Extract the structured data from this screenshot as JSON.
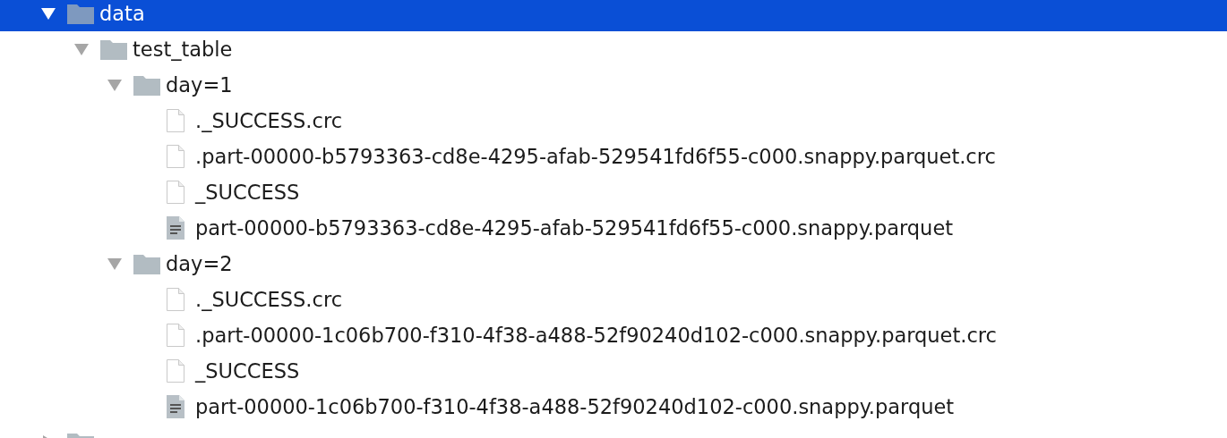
{
  "tree": [
    {
      "name": "data",
      "kind": "folder",
      "expanded": true,
      "selected": true,
      "children": [
        {
          "name": "test_table",
          "kind": "folder",
          "expanded": true,
          "selected": false,
          "children": [
            {
              "name": "day=1",
              "kind": "folder",
              "expanded": true,
              "selected": false,
              "children": [
                {
                  "name": "._SUCCESS.crc",
                  "kind": "file",
                  "selected": false
                },
                {
                  "name": ".part-00000-b5793363-cd8e-4295-afab-529541fd6f55-c000.snappy.parquet.crc",
                  "kind": "file",
                  "selected": false
                },
                {
                  "name": "_SUCCESS",
                  "kind": "file",
                  "selected": false
                },
                {
                  "name": "part-00000-b5793363-cd8e-4295-afab-529541fd6f55-c000.snappy.parquet",
                  "kind": "document",
                  "selected": false
                }
              ]
            },
            {
              "name": "day=2",
              "kind": "folder",
              "expanded": true,
              "selected": false,
              "children": [
                {
                  "name": "._SUCCESS.crc",
                  "kind": "file",
                  "selected": false
                },
                {
                  "name": ".part-00000-1c06b700-f310-4f38-a488-52f90240d102-c000.snappy.parquet.crc",
                  "kind": "file",
                  "selected": false
                },
                {
                  "name": "_SUCCESS",
                  "kind": "file",
                  "selected": false
                },
                {
                  "name": "part-00000-1c06b700-f310-4f38-a488-52f90240d102-c000.snappy.parquet",
                  "kind": "document",
                  "selected": false
                }
              ]
            }
          ]
        }
      ]
    },
    {
      "kind": "folder",
      "expanded": false,
      "selected": false
    }
  ]
}
